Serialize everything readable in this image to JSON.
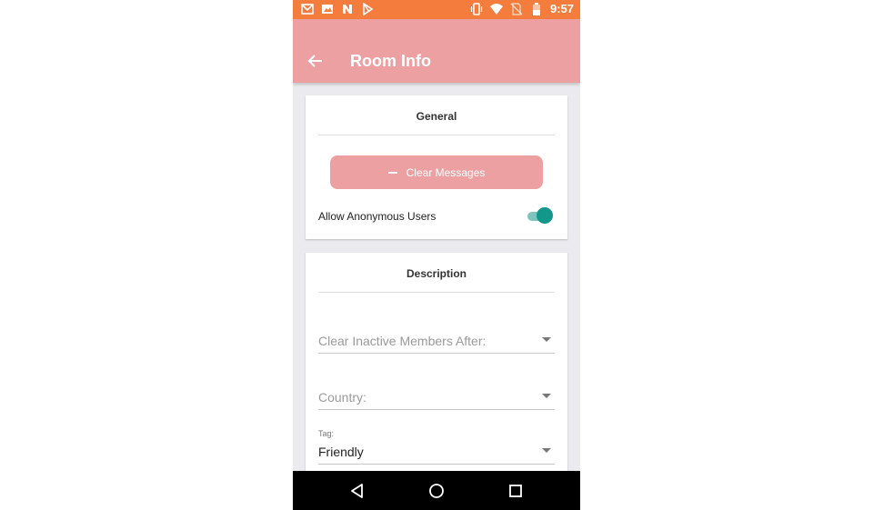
{
  "status_bar": {
    "time": "9:57",
    "left_icons": [
      "gmail-icon",
      "image-icon",
      "n-icon",
      "play-store-icon"
    ],
    "right_icons": [
      "vibrate-icon",
      "wifi-icon",
      "no-sim-icon",
      "battery-icon"
    ]
  },
  "app_bar": {
    "title": "Room Info",
    "back_icon": "arrow-left-icon"
  },
  "general": {
    "title": "General",
    "clear_button_label": "Clear Messages",
    "anonymous_label": "Allow Anonymous Users",
    "anonymous_enabled": true
  },
  "description": {
    "title": "Description",
    "inactive_field": {
      "placeholder": "Clear Inactive Members After:"
    },
    "country_field": {
      "placeholder": "Country:"
    },
    "tag_field": {
      "label": "Tag:",
      "value": "Friendly"
    }
  },
  "colors": {
    "status_bar": "#f47c3c",
    "app_bar": "#eda0a1",
    "toggle_on": "#12978a",
    "background": "#ebebef"
  },
  "nav_bar": {
    "buttons": [
      "back-triangle-icon",
      "home-circle-icon",
      "recents-square-icon"
    ]
  }
}
